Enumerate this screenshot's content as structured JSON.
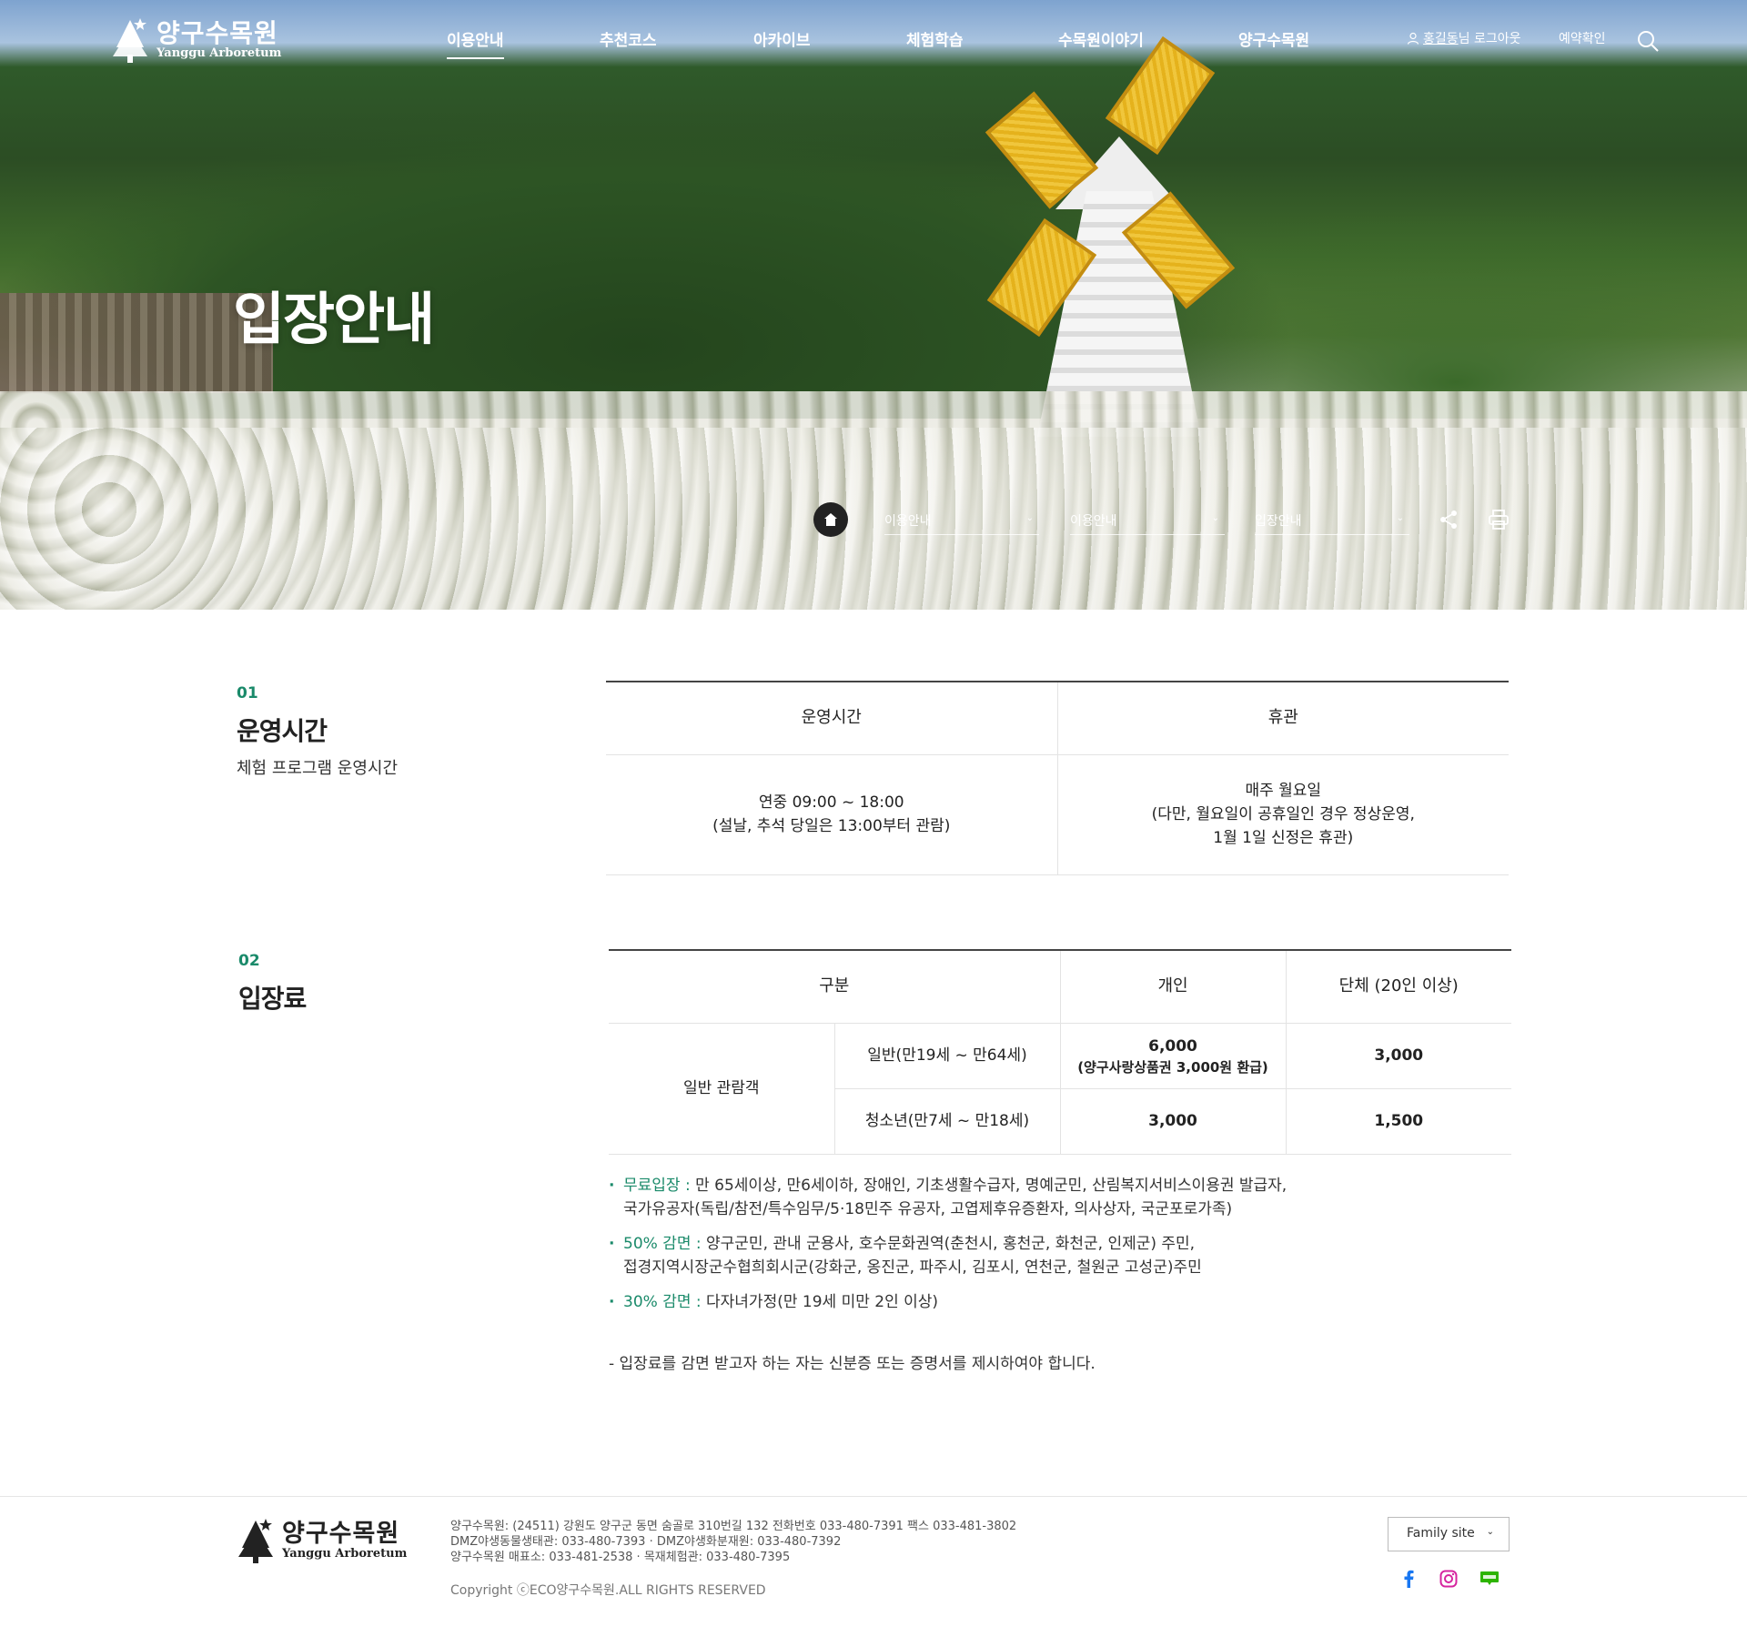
{
  "header": {
    "logo_ko": "양구수목원",
    "logo_en": "Yanggu Arboretum",
    "nav": [
      "이용안내",
      "추천코스",
      "아카이브",
      "체험학습",
      "수목원이야기",
      "양구수목원"
    ],
    "user_name": "홍길동",
    "user_suffix": "님",
    "logout": "로그아웃",
    "reservation": "예약확인"
  },
  "hero": {
    "title": "입장안내",
    "breadcrumb": [
      "이용안내",
      "이용안내",
      "입장안내"
    ]
  },
  "sections": {
    "hours": {
      "no": "01",
      "title": "운영시간",
      "desc": "체험 프로그램 운영시간",
      "head": [
        "운영시간",
        "휴관"
      ],
      "time_1": "연중 09:00 ~ 18:00",
      "time_2": "(설날, 추석 당일은 13:00부터 관람)",
      "closed_1": "매주 월요일",
      "closed_2": "(다만, 월요일이 공휴일인 경우 정상운영,",
      "closed_3": "1월 1일 신정은 휴관)"
    },
    "fee": {
      "no": "02",
      "title": "입장료",
      "head": [
        "구분",
        "개인",
        "단체 (20인 이상)"
      ],
      "group": "일반 관람객",
      "rows": [
        {
          "label": "일반(만19세 ~ 만64세)",
          "personal": "6,000",
          "personal_note": "(양구사랑상품권 3,000원 환급)",
          "group": "3,000"
        },
        {
          "label": "청소년(만7세 ~ 만18세)",
          "personal": "3,000",
          "group": "1,500"
        }
      ]
    },
    "notes": {
      "free_label": "무료입장 :",
      "free_text_1": " 만 65세이상, 만6세이하, 장애인, 기초생활수급자, 명예군민, 산림복지서비스이용권 발급자,",
      "free_text_2": "국가유공자(독립/참전/특수임무/5·18민주 유공자, 고엽제후유증환자, 의사상자, 국군포로가족)",
      "half_label": "50% 감면 :",
      "half_text_1": " 양구군민, 관내 군용사, 호수문화권역(춘천시, 홍천군, 화천군, 인제군) 주민,",
      "half_text_2": "접경지역시장군수협희회시군(강화군, 옹진군, 파주시, 김포시, 연천군, 철원군 고성군)주민",
      "thirty_label": "30% 감면 :",
      "thirty_text": " 다자녀가정(만 19세 미만 2인 이상)",
      "warning": "- 입장료를 감면 받고자 하는 자는 신분증 또는 증명서를 제시하여야 합니다."
    }
  },
  "footer": {
    "logo_ko": "양구수목원",
    "logo_en": "Yanggu Arboretum",
    "info_1": "양구수목원: (24511) 강원도 양구군 동면 숨골로 310번길 132 전화번호 033-480-7391 팩스 033-481-3802",
    "info_2": "DMZ야생동물생태관: 033-480-7393 · DMZ야생화분재원: 033-480-7392",
    "info_3": "양구수목원 매표소: 033-481-2538 · 목재체험관: 033-480-7395",
    "copyright": "Copyright ⓒECO양구수목원.ALL RIGHTS RESERVED",
    "family_site": "Family site",
    "sns": [
      "facebook-icon",
      "instagram-icon",
      "blog-icon"
    ]
  },
  "colors": {
    "accent": "#1a8a6a",
    "dark": "#222222",
    "line": "#444444"
  }
}
